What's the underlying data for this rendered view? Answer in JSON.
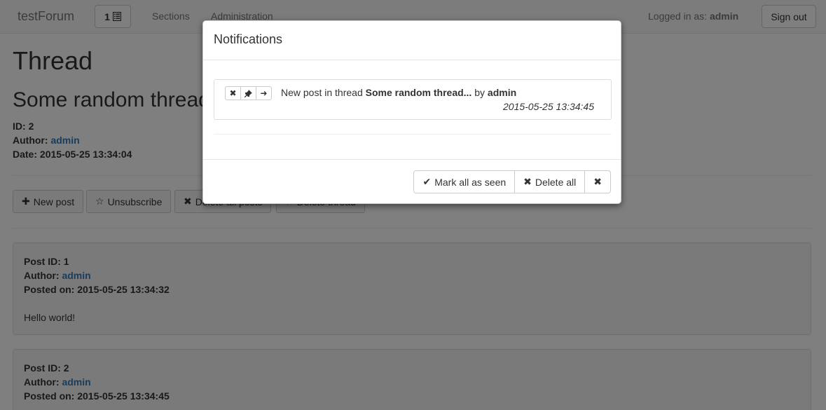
{
  "navbar": {
    "brand": "testForum",
    "notif_count": "1",
    "links": {
      "sections": "Sections",
      "administration": "Administration"
    },
    "logged_in_label": "Logged in as:",
    "logged_in_user": "admin",
    "sign_out": "Sign out"
  },
  "page": {
    "title": "Thread",
    "thread_title": "Some random thread",
    "id_label": "ID:",
    "id_value": "2",
    "author_label": "Author:",
    "author_value": "admin",
    "date_label": "Date:",
    "date_value": "2015-05-25 13:34:04"
  },
  "actions": {
    "new_post": "New post",
    "unsubscribe": "Unsubscribe",
    "delete_all_posts": "Delete all posts",
    "delete_thread": "Delete thread"
  },
  "posts": [
    {
      "id_label": "Post ID:",
      "id": "1",
      "author_label": "Author:",
      "author": "admin",
      "posted_label": "Posted on:",
      "posted": "2015-05-25 13:34:32",
      "body": "Hello world!"
    },
    {
      "id_label": "Post ID:",
      "id": "2",
      "author_label": "Author:",
      "author": "admin",
      "posted_label": "Posted on:",
      "posted": "2015-05-25 13:34:45"
    }
  ],
  "modal": {
    "title": "Notifications",
    "notification": {
      "prefix": "New post in thread",
      "thread": "Some random thread...",
      "by": "by",
      "user": "admin",
      "date": "2015-05-25 13:34:45"
    },
    "footer": {
      "mark_all_seen": "Mark all as seen",
      "delete_all": "Delete all"
    }
  },
  "icons": {
    "list": "list-icon",
    "plus": "plus-icon",
    "star": "star-icon",
    "remove": "remove-icon",
    "pin": "pin-icon",
    "arrow": "arrow-right-icon",
    "check": "check-icon"
  }
}
